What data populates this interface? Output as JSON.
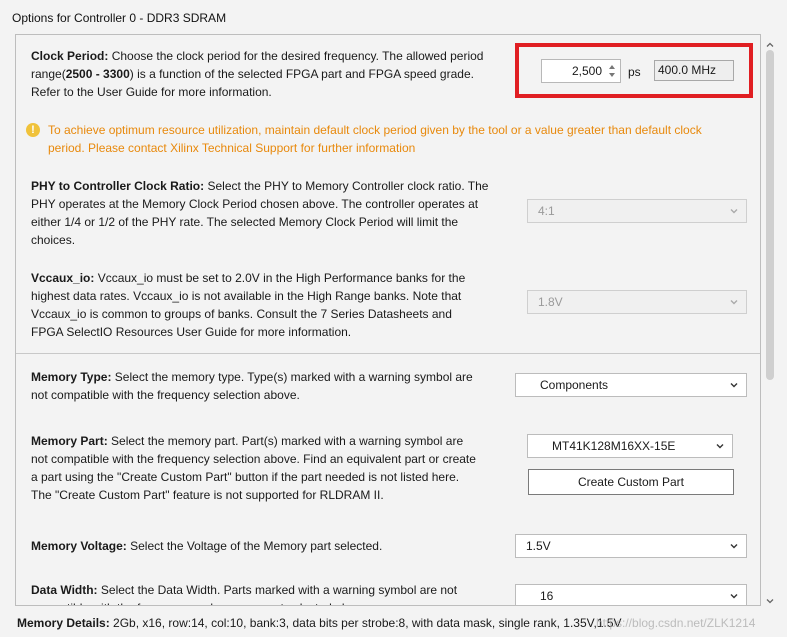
{
  "window": {
    "title": "Options for Controller 0 - DDR3 SDRAM"
  },
  "clock": {
    "label": "Clock Period:",
    "desc_pre": " Choose the clock period for the desired frequency. The allowed period\nrange(",
    "range": "2500 - 3300",
    "desc_post": ") is a function of the selected FPGA part and FPGA speed grade.\nRefer to the User Guide for more information.",
    "value": "2,500",
    "unit": "ps",
    "frequency": "400.0 MHz",
    "highlight_color": "#e01e22"
  },
  "warning": {
    "icon": "warning-icon",
    "text": "To achieve optimum resource utilization, maintain default clock period given by the tool or a value greater than default clock\nperiod. Please contact Xilinx Technical Support for further information",
    "color": "#e8890c"
  },
  "phy": {
    "label": "PHY to Controller Clock Ratio:",
    "desc": " Select the PHY to Memory Controller clock ratio. The\nPHY operates at the Memory Clock Period chosen above. The controller operates at\neither 1/4 or 1/2 of the PHY rate. The selected Memory Clock Period will limit the\nchoices.",
    "value": "4:1"
  },
  "vccaux": {
    "label": "Vccaux_io:",
    "desc": " Vccaux_io must be set to 2.0V in the High Performance banks for the\nhighest data rates. Vccaux_io is not available in the High Range banks. Note that\nVccaux_io is common to groups of banks. Consult the 7 Series Datasheets and\nFPGA SelectIO Resources User Guide for more information.",
    "value": "1.8V"
  },
  "memory_type": {
    "label": "Memory Type:",
    "desc": " Select the memory type. Type(s) marked with a warning symbol are\nnot compatible with the frequency selection above.",
    "value": "Components"
  },
  "memory_part": {
    "label": "Memory Part:",
    "desc": " Select the memory part. Part(s) marked with a warning symbol are\nnot compatible with the frequency selection above. Find an equivalent part or create\na part using the \"Create Custom Part\" button if the part needed is not listed here.\nThe \"Create Custom Part\" feature is not supported for RLDRAM II.",
    "value": "MT41K128M16XX-15E",
    "custom_button": "Create Custom Part"
  },
  "memory_voltage": {
    "label": "Memory Voltage:",
    "desc": " Select the Voltage of the Memory part selected.",
    "value": "1.5V"
  },
  "data_width": {
    "label": "Data Width:",
    "desc": " Select the Data Width. Parts marked with a warning symbol are not\ncompatible with the frequency and memory part selected above.",
    "value": "16"
  },
  "footer": {
    "label": "Memory Details:",
    "text": " 2Gb, x16, row:14, col:10, bank:3, data bits per strobe:8, with data mask, single rank, 1.35V,1.5V"
  },
  "watermark": "https://blog.csdn.net/ZLK1214"
}
